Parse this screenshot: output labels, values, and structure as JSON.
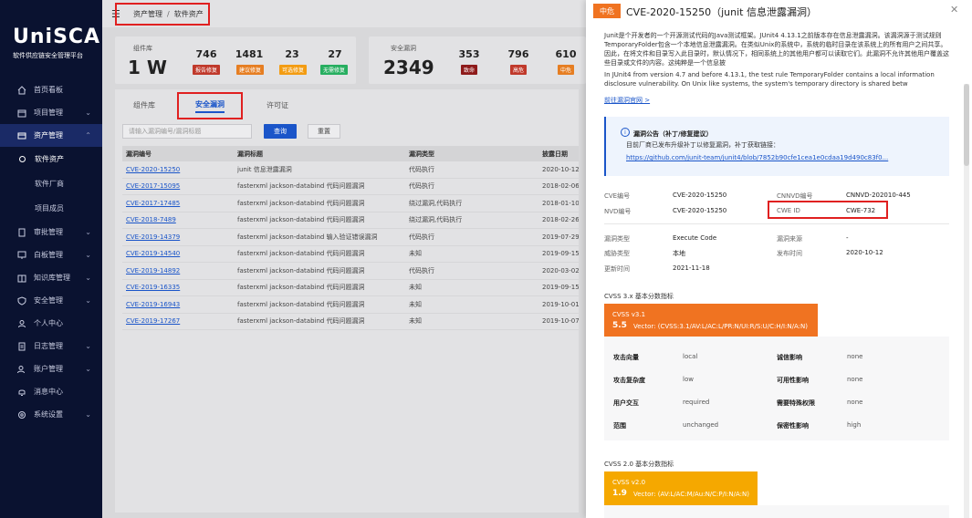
{
  "brand": {
    "logo": "UniSCA",
    "subtitle": "软件供应链安全管理平台"
  },
  "sidebar": {
    "items": [
      {
        "label": "首页看板",
        "icon": "home-icon"
      },
      {
        "label": "项目管理",
        "icon": "project-icon"
      },
      {
        "label": "资产管理",
        "icon": "asset-icon"
      },
      {
        "label": "审批管理",
        "icon": "approval-icon"
      },
      {
        "label": "白板管理",
        "icon": "whiteboard-icon"
      },
      {
        "label": "知识库管理",
        "icon": "knowledge-icon"
      },
      {
        "label": "安全管理",
        "icon": "shield-icon"
      },
      {
        "label": "个人中心",
        "icon": "user-icon"
      },
      {
        "label": "日志管理",
        "icon": "log-icon"
      },
      {
        "label": "账户管理",
        "icon": "account-icon"
      },
      {
        "label": "消息中心",
        "icon": "bell-icon"
      },
      {
        "label": "系统设置",
        "icon": "gear-icon"
      }
    ],
    "sub_items": [
      "软件资产",
      "软件厂商",
      "项目成员"
    ]
  },
  "breadcrumb": {
    "parent": "资产管理",
    "current": "软件资产"
  },
  "stats": {
    "components": {
      "label": "组件库",
      "value": "1 W"
    },
    "comp_counts": [
      {
        "value": "746",
        "tag": "报告修复",
        "color": "#c0392b"
      },
      {
        "value": "1481",
        "tag": "建议修复",
        "color": "#e67e22"
      },
      {
        "value": "23",
        "tag": "可选修复",
        "color": "#f39c12"
      },
      {
        "value": "27",
        "tag": "无需修复",
        "color": "#27ae60"
      }
    ],
    "vulns": {
      "label": "安全漏洞",
      "value": "2349"
    },
    "vuln_counts": [
      {
        "value": "353",
        "tag": "致命",
        "color": "#8e1b1b"
      },
      {
        "value": "796",
        "tag": "高危",
        "color": "#c0392b"
      },
      {
        "value": "610",
        "tag": "中危",
        "color": "#e67e22"
      }
    ]
  },
  "tabs": {
    "tab1": "组件库",
    "tab2": "安全漏洞",
    "tab3": "许可证"
  },
  "search": {
    "placeholder": "请输入漏洞编号/漏洞标题",
    "query_label": "查询",
    "reset_label": "重置"
  },
  "table": {
    "headers": [
      "漏洞编号",
      "漏洞标题",
      "漏洞类型",
      "披露日期"
    ],
    "rows": [
      [
        "CVE-2020-15250",
        "junit 信息泄露漏洞",
        "代码执行",
        "2020-10-12"
      ],
      [
        "CVE-2017-15095",
        "fasterxml jackson-databind 代码问题漏洞",
        "代码执行",
        "2018-02-06"
      ],
      [
        "CVE-2017-17485",
        "fasterxml jackson-databind 代码问题漏洞",
        "绕过漏洞,代码执行",
        "2018-01-10"
      ],
      [
        "CVE-2018-7489",
        "fasterxml jackson-databind 代码问题漏洞",
        "绕过漏洞,代码执行",
        "2018-02-26"
      ],
      [
        "CVE-2019-14379",
        "fasterxml jackson-databind 输入验证错误漏洞",
        "代码执行",
        "2019-07-29"
      ],
      [
        "CVE-2019-14540",
        "fasterxml jackson-databind 代码问题漏洞",
        "未知",
        "2019-09-15"
      ],
      [
        "CVE-2019-14892",
        "fasterxml jackson-databind 代码问题漏洞",
        "代码执行",
        "2020-03-02"
      ],
      [
        "CVE-2019-16335",
        "fasterxml jackson-databind 代码问题漏洞",
        "未知",
        "2019-09-15"
      ],
      [
        "CVE-2019-16943",
        "fasterxml jackson-databind 代码问题漏洞",
        "未知",
        "2019-10-01"
      ],
      [
        "CVE-2019-17267",
        "fasterxml jackson-databind 代码问题漏洞",
        "未知",
        "2019-10-07"
      ]
    ]
  },
  "drawer": {
    "severity": "中危",
    "title": "CVE-2020-15250（junit 信息泄露漏洞）",
    "desc_cn": "Junit是个开发者的一个开源测试代码的Java测试框架。JUnit4 4.13.1之前版本存在信息泄露漏洞。该漏洞源于测试规则TemporaryFolder包含一个本地信息泄露漏洞。在类似Unix的系统中，系统的临时目录在该系统上的所有用户之间共享。因此，在将文件和目录写入此目录时，默认情况下，相同系统上的其他用户都可以读取它们。此漏洞不允许其他用户覆盖这些目录或文件的内容。这纯粹是一个信息披",
    "desc_en": "In JUnit4 from version 4.7 and before 4.13.1, the test rule TemporaryFolder contains a local information disclosure vulnerability. On Unix like systems, the system's temporary directory is shared betw",
    "link": "前往漏洞官网 >",
    "notice_title": "漏洞公告（补丁/修复建议）",
    "notice_text": "目前厂商已发布升级补丁以修复漏洞，补丁获取链接：",
    "notice_url": "https://github.com/junit-team/junit4/blob/7852b90cfe1cea1e0cdaa19d490c83f0...",
    "info": {
      "cve_label": "CVE编号",
      "cve": "CVE-2020-15250",
      "cnnvd_label": "CNNVD编号",
      "cnnvd": "CNNVD-202010-445",
      "nvd_label": "NVD编号",
      "nvd": "CVE-2020-15250",
      "cwe_label": "CWE ID",
      "cwe": "CWE-732",
      "type_label": "漏洞类型",
      "type": "Execute Code",
      "source_label": "漏洞来源",
      "source": "-",
      "threat_label": "威胁类型",
      "threat": "本地",
      "publish_label": "发布时间",
      "publish": "2020-10-12",
      "update_label": "更新时间",
      "update": "2021-11-18"
    },
    "cvss3": {
      "section": "CVSS 3.x 基本分数指标",
      "name": "CVSS v3.1",
      "score": "5.5",
      "vector": "Vector: (CVSS:3.1/AV:L/AC:L/PR:N/UI:R/S:U/C:H/I:N/A:N)",
      "metrics": [
        {
          "label": "攻击向量",
          "value": "local",
          "label2": "诚信影响",
          "value2": "none"
        },
        {
          "label": "攻击复杂度",
          "value": "low",
          "label2": "可用性影响",
          "value2": "none"
        },
        {
          "label": "用户交互",
          "value": "required",
          "label2": "需要特殊权限",
          "value2": "none"
        },
        {
          "label": "范围",
          "value": "unchanged",
          "label2": "保密性影响",
          "value2": "high"
        }
      ]
    },
    "cvss2": {
      "section": "CVSS 2.0 基本分数指标",
      "name": "CVSS v2.0",
      "score": "1.9",
      "vector": "Vector: (AV:L/AC:M/Au:N/C:P/I:N/A:N)"
    }
  }
}
